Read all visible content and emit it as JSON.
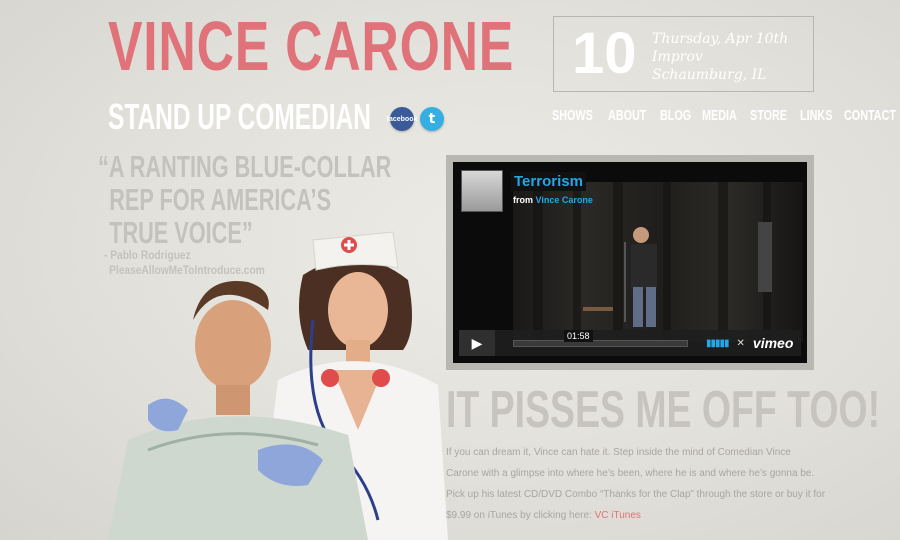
{
  "header": {
    "site_name": "VINCE CARONE",
    "tagline": "STAND UP COMEDIAN",
    "social": {
      "facebook_label": "facebook",
      "twitter_label": "t"
    }
  },
  "event": {
    "day": "10",
    "date": "Thursday, Apr 10th",
    "venue": "Improv",
    "location": "Schaumburg, IL"
  },
  "nav": {
    "items": [
      "SHOWS",
      "ABOUT",
      "BLOG",
      "MEDIA",
      "STORE",
      "LINKS",
      "CONTACT"
    ]
  },
  "quote": {
    "line1": "“A RANTING BLUE-COLLAR",
    "line2": "REP FOR AMERICA’S",
    "line3": "TRUE VOICE”",
    "author": "- Pablo Rodriguez",
    "source": "PleaseAllowMeToIntroduce.com"
  },
  "video": {
    "title": "Terrorism",
    "from_prefix": "from",
    "from_author": "Vince Carone",
    "timecode": "01:58",
    "brand": "vimeo"
  },
  "main": {
    "headline": "IT PISSES ME OFF TOO!",
    "body": "If you can dream it, Vince can hate it. Step inside the mind of Comedian Vince Carone with a glimpse into where he’s been, where he is and where he’s gonna be. Pick up his latest CD/DVD Combo “Thanks for the Clap” through the store or buy it for $9.99 on iTunes by clicking here:",
    "link_label": "VC iTunes"
  },
  "colors": {
    "accent": "#e0737a",
    "vimeo_blue": "#23a7e6",
    "muted_text": "#c4c2bc"
  }
}
